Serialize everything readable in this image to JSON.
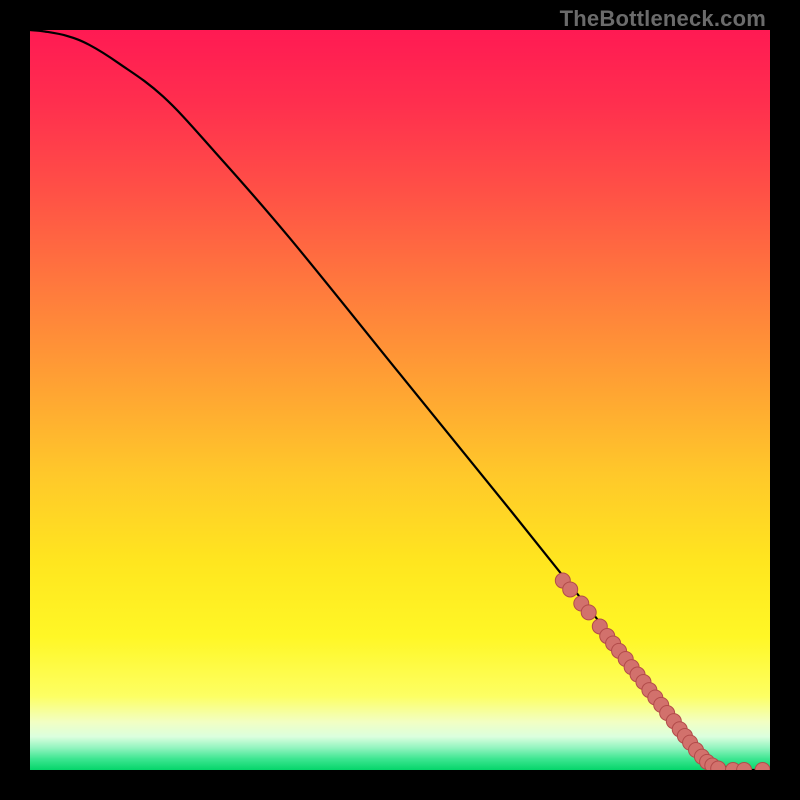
{
  "watermark": "TheBottleneck.com",
  "colors": {
    "curve": "#000000",
    "marker_fill": "#d2716c",
    "marker_stroke": "#b24b4a"
  },
  "chart_data": {
    "type": "line",
    "title": "",
    "xlabel": "",
    "ylabel": "",
    "xlim": [
      0,
      100
    ],
    "ylim": [
      0,
      100
    ],
    "grid": false,
    "legend": false,
    "series": [
      {
        "name": "bottleneck-curve",
        "x": [
          0,
          2,
          5,
          8,
          12,
          18,
          25,
          35,
          50,
          65,
          75,
          80,
          85,
          88,
          90,
          92,
          94,
          96,
          98,
          100
        ],
        "y": [
          100,
          99.8,
          99.2,
          98.0,
          95.5,
          91.0,
          83.5,
          72.0,
          53.5,
          35.0,
          22.5,
          16.0,
          9.5,
          5.5,
          2.8,
          1.2,
          0.4,
          0.05,
          0.0,
          0.0
        ]
      }
    ],
    "markers": [
      {
        "name": "marker-series",
        "x": [
          72,
          73,
          74.5,
          75.5,
          77,
          78,
          78.8,
          79.6,
          80.5,
          81.3,
          82.1,
          82.9,
          83.7,
          84.5,
          85.3,
          86.1,
          87,
          87.8,
          88.5,
          89.2,
          90,
          90.8,
          91.5,
          92.2,
          93,
          95,
          96.5,
          99
        ],
        "y": [
          25.6,
          24.4,
          22.5,
          21.3,
          19.4,
          18.1,
          17.1,
          16.1,
          15.0,
          13.9,
          12.9,
          11.9,
          10.8,
          9.8,
          8.8,
          7.7,
          6.6,
          5.5,
          4.6,
          3.7,
          2.7,
          1.8,
          1.1,
          0.6,
          0.2,
          0.0,
          0.0,
          0.0
        ]
      }
    ]
  }
}
